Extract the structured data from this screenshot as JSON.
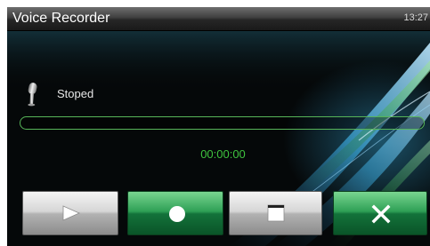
{
  "app": {
    "title": "Voice Recorder",
    "clock": "13:27"
  },
  "recorder": {
    "status": "Stoped",
    "elapsed": "00:00:00",
    "progress_percent": 0
  },
  "controls": [
    {
      "action": "play",
      "icon": "play-icon",
      "style": "grey"
    },
    {
      "action": "record",
      "icon": "record-icon",
      "style": "green"
    },
    {
      "action": "stop",
      "icon": "stop-icon",
      "style": "grey"
    },
    {
      "action": "close",
      "icon": "close-icon",
      "style": "green"
    }
  ],
  "colors": {
    "accent_green": "#3fae4a",
    "timer_green": "#3ec33e",
    "progress_border": "#57b558"
  }
}
